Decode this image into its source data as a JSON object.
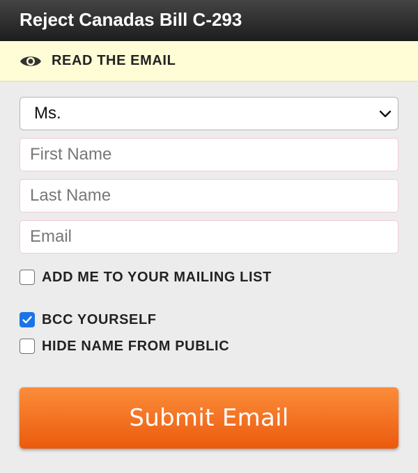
{
  "header": {
    "title": "Reject Canadas Bill C-293"
  },
  "read_bar": {
    "icon": "eye-icon",
    "label": "READ THE EMAIL"
  },
  "form": {
    "title_select": {
      "value": "Ms."
    },
    "first_name": {
      "placeholder": "First Name",
      "value": ""
    },
    "last_name": {
      "placeholder": "Last Name",
      "value": ""
    },
    "email": {
      "placeholder": "Email",
      "value": ""
    },
    "checkboxes": {
      "mailing_list": {
        "label": "ADD ME TO YOUR MAILING LIST",
        "checked": false
      },
      "bcc": {
        "label": "BCC YOURSELF",
        "checked": true
      },
      "hide_name": {
        "label": "HIDE NAME FROM PUBLIC",
        "checked": false
      }
    },
    "submit_label": "Submit Email"
  },
  "colors": {
    "header_bg": "#2a2a2a",
    "read_bar_bg": "#fefdd6",
    "accent_orange": "#f47a24",
    "checkbox_blue": "#1a73e8"
  }
}
